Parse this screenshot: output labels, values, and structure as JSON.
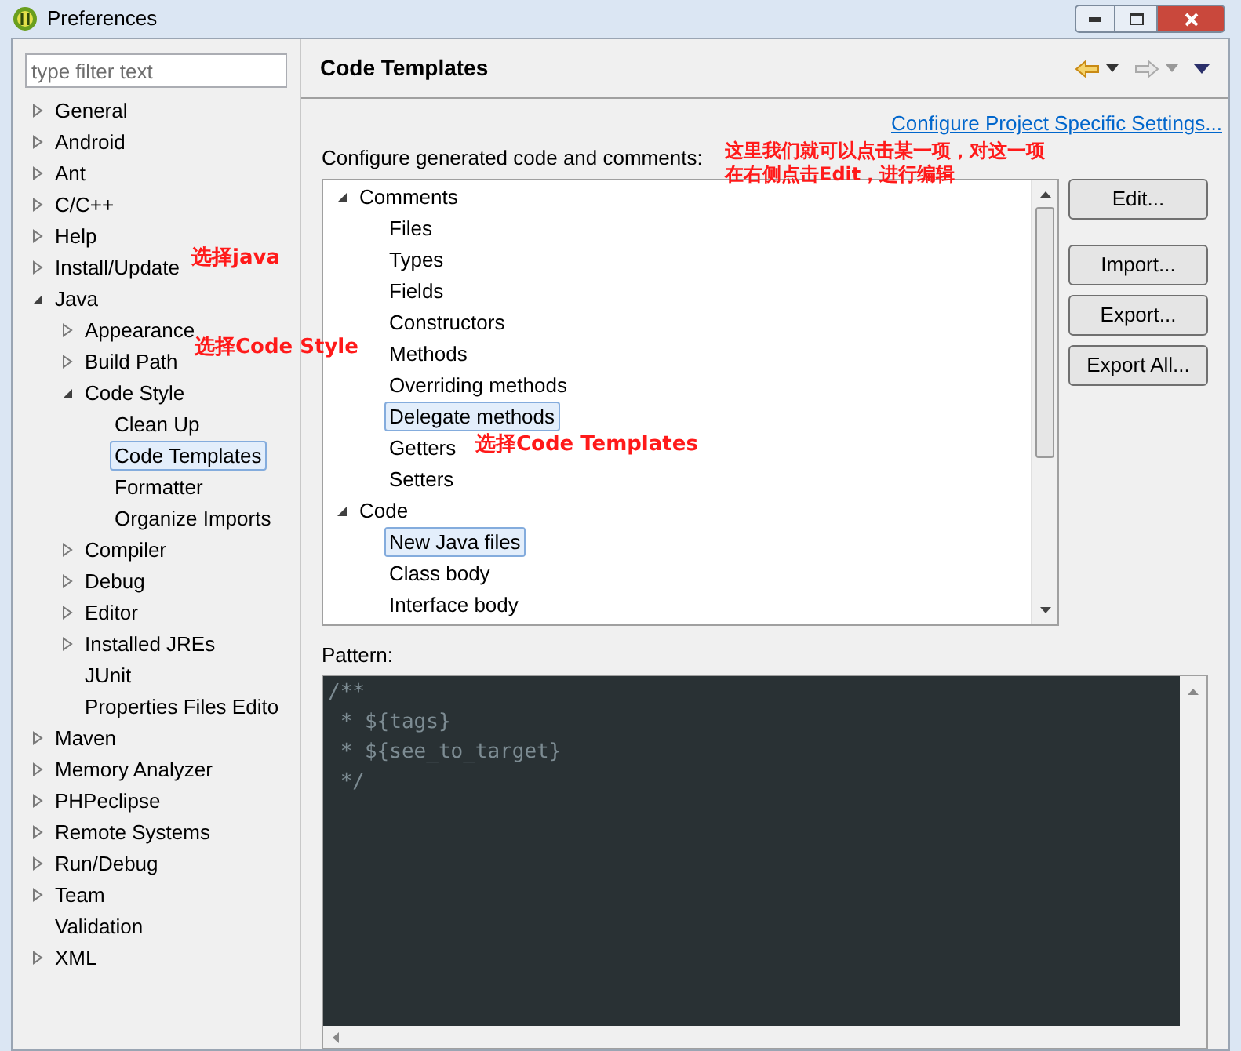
{
  "window": {
    "title": "Preferences"
  },
  "sidebar": {
    "filter_placeholder": "type filter text",
    "tree": [
      {
        "label": "General",
        "expanded": false,
        "selected": false
      },
      {
        "label": "Android",
        "expanded": false,
        "selected": false
      },
      {
        "label": "Ant",
        "expanded": false,
        "selected": false
      },
      {
        "label": "C/C++",
        "expanded": false,
        "selected": false
      },
      {
        "label": "Help",
        "expanded": false,
        "selected": false
      },
      {
        "label": "Install/Update",
        "expanded": false,
        "selected": false
      },
      {
        "label": "Java",
        "expanded": true,
        "selected": false,
        "children": [
          {
            "label": "Appearance",
            "expanded": false,
            "selected": false
          },
          {
            "label": "Build Path",
            "expanded": false,
            "selected": false
          },
          {
            "label": "Code Style",
            "expanded": true,
            "selected": false,
            "children": [
              {
                "label": "Clean Up",
                "selected": false
              },
              {
                "label": "Code Templates",
                "selected": true
              },
              {
                "label": "Formatter",
                "selected": false
              },
              {
                "label": "Organize Imports",
                "selected": false
              }
            ]
          },
          {
            "label": "Compiler",
            "expanded": false,
            "selected": false
          },
          {
            "label": "Debug",
            "expanded": false,
            "selected": false
          },
          {
            "label": "Editor",
            "expanded": false,
            "selected": false
          },
          {
            "label": "Installed JREs",
            "expanded": false,
            "selected": false
          },
          {
            "label": "JUnit",
            "selected": false
          },
          {
            "label": "Properties Files Edito",
            "selected": false
          }
        ]
      },
      {
        "label": "Maven",
        "expanded": false,
        "selected": false
      },
      {
        "label": "Memory Analyzer",
        "expanded": false,
        "selected": false
      },
      {
        "label": "PHPeclipse",
        "expanded": false,
        "selected": false
      },
      {
        "label": "Remote Systems",
        "expanded": false,
        "selected": false
      },
      {
        "label": "Run/Debug",
        "expanded": false,
        "selected": false
      },
      {
        "label": "Team",
        "expanded": false,
        "selected": false
      },
      {
        "label": "Validation",
        "selected": false
      },
      {
        "label": "XML",
        "expanded": false,
        "selected": false
      }
    ]
  },
  "page": {
    "title": "Code Templates",
    "project_link": "Configure Project Specific Settings...",
    "tree_label": "Configure generated code and comments:",
    "templates": [
      {
        "label": "Comments",
        "expanded": true,
        "selected": false,
        "children": [
          {
            "label": "Files",
            "selected": false
          },
          {
            "label": "Types",
            "selected": false
          },
          {
            "label": "Fields",
            "selected": false
          },
          {
            "label": "Constructors",
            "selected": false
          },
          {
            "label": "Methods",
            "selected": false
          },
          {
            "label": "Overriding methods",
            "selected": false
          },
          {
            "label": "Delegate methods",
            "selected": true
          },
          {
            "label": "Getters",
            "selected": false
          },
          {
            "label": "Setters",
            "selected": false
          }
        ]
      },
      {
        "label": "Code",
        "expanded": true,
        "selected": false,
        "children": [
          {
            "label": "New Java files",
            "selected": true
          },
          {
            "label": "Class body",
            "selected": false
          },
          {
            "label": "Interface body",
            "selected": false
          }
        ]
      }
    ],
    "buttons": [
      "Edit...",
      "Import...",
      "Export...",
      "Export All..."
    ],
    "pattern_label": "Pattern:",
    "pattern": [
      "/**",
      " * ${tags}",
      " * ${see_to_target}",
      " */"
    ]
  },
  "annotations": [
    "选择java",
    "选择Code Style",
    "选择Code Templates",
    "这里我们就可以点击某一项，对这一项",
    "在右侧点击Edit，进行编辑"
  ]
}
